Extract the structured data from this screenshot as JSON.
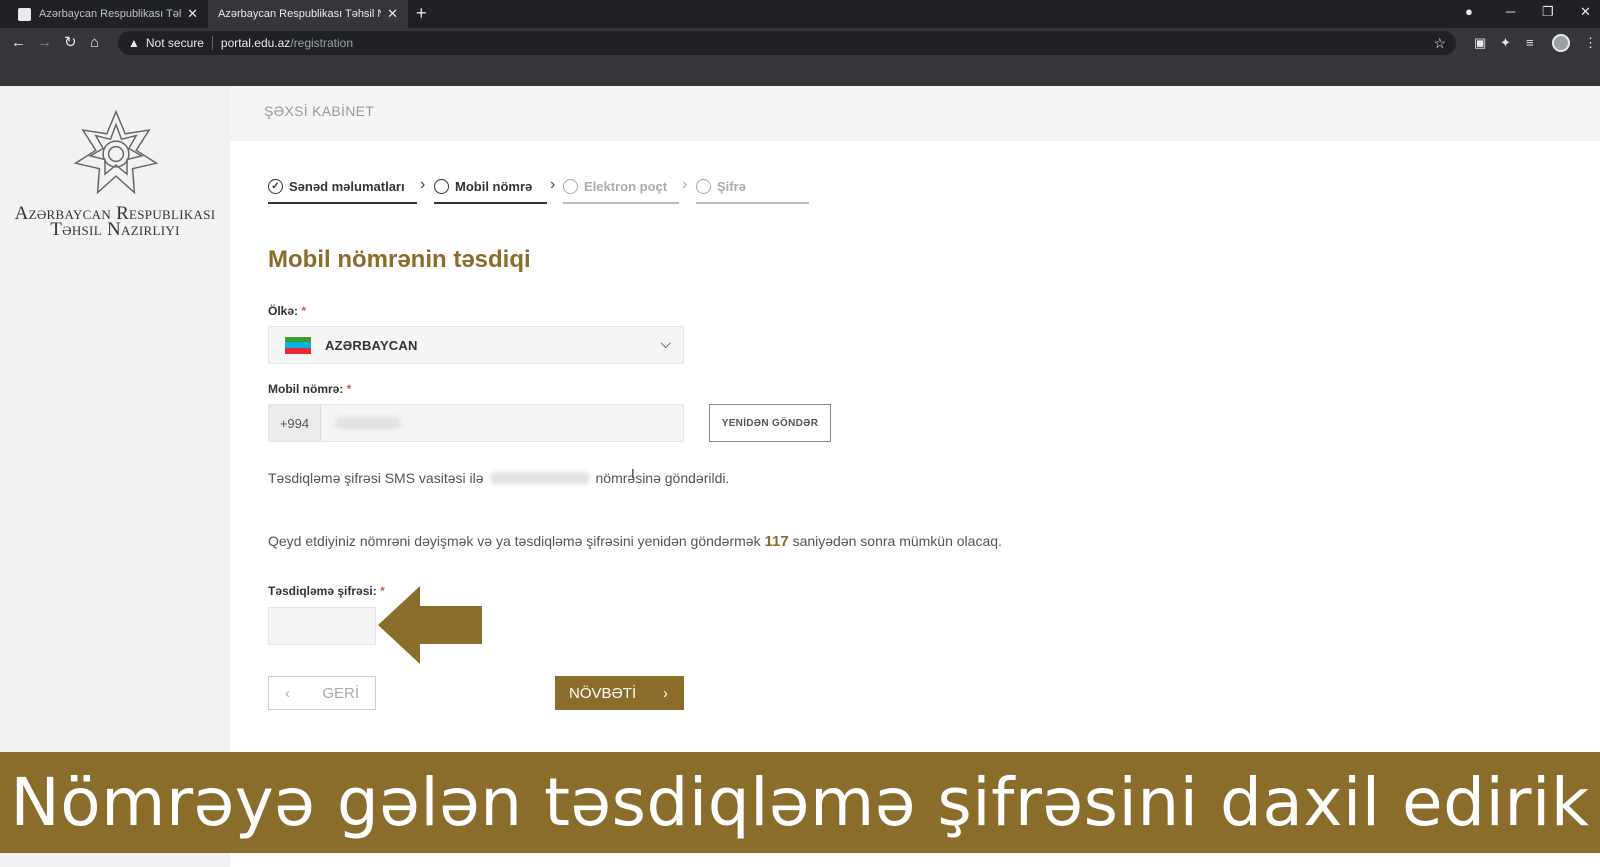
{
  "browser": {
    "tabs": [
      {
        "title": "Azərbaycan Respublikası Təhsil N",
        "active": false
      },
      {
        "title": "Azərbaycan Respublikası Təhsil N",
        "active": true
      }
    ],
    "new_tab": "+",
    "close": "✕",
    "security": "Not secure",
    "url_host": "portal.edu.az",
    "url_path": "/registration"
  },
  "sidebar": {
    "ministry_line1": "Azərbaycan Respublikası",
    "ministry_line2": "Təhsil Nazirliyi"
  },
  "header": {
    "title": "ŞƏXSİ KABİNET"
  },
  "steps": [
    {
      "label": "Sənəd məlumatları",
      "state": "done"
    },
    {
      "label": "Mobil nömrə",
      "state": "active"
    },
    {
      "label": "Elektron poçt",
      "state": "disabled"
    },
    {
      "label": "Şifrə",
      "state": "disabled"
    }
  ],
  "form": {
    "title": "Mobil nömrənin təsdiqi",
    "country_label": "Ölkə:",
    "country_value": "AZƏRBAYCAN",
    "phone_label": "Mobil nömrə:",
    "phone_prefix": "+994",
    "resend_label": "YENİDƏN GÖNDƏR",
    "sms_info_before": "Təsdiqləmə şifrəsi SMS vasitəsi ilə",
    "sms_info_after": "nömrəsinə göndərildi.",
    "wait_before": "Qeyd etdiyiniz nömrəni dəyişmək və ya təsdiqləmə şifrəsini yenidən göndərmək",
    "wait_seconds": "117",
    "wait_after": "saniyədən sonra mümkün olacaq.",
    "code_label": "Təsdiqləmə şifrəsi:",
    "required_mark": "*",
    "back_label": "GERİ",
    "next_label": "NÖVBƏTİ"
  },
  "caption": "Nömrəyə gələn təsdiqləmə şifrəsini daxil edirik",
  "colors": {
    "accent": "#8a6d2b",
    "required": "#d9534f"
  }
}
